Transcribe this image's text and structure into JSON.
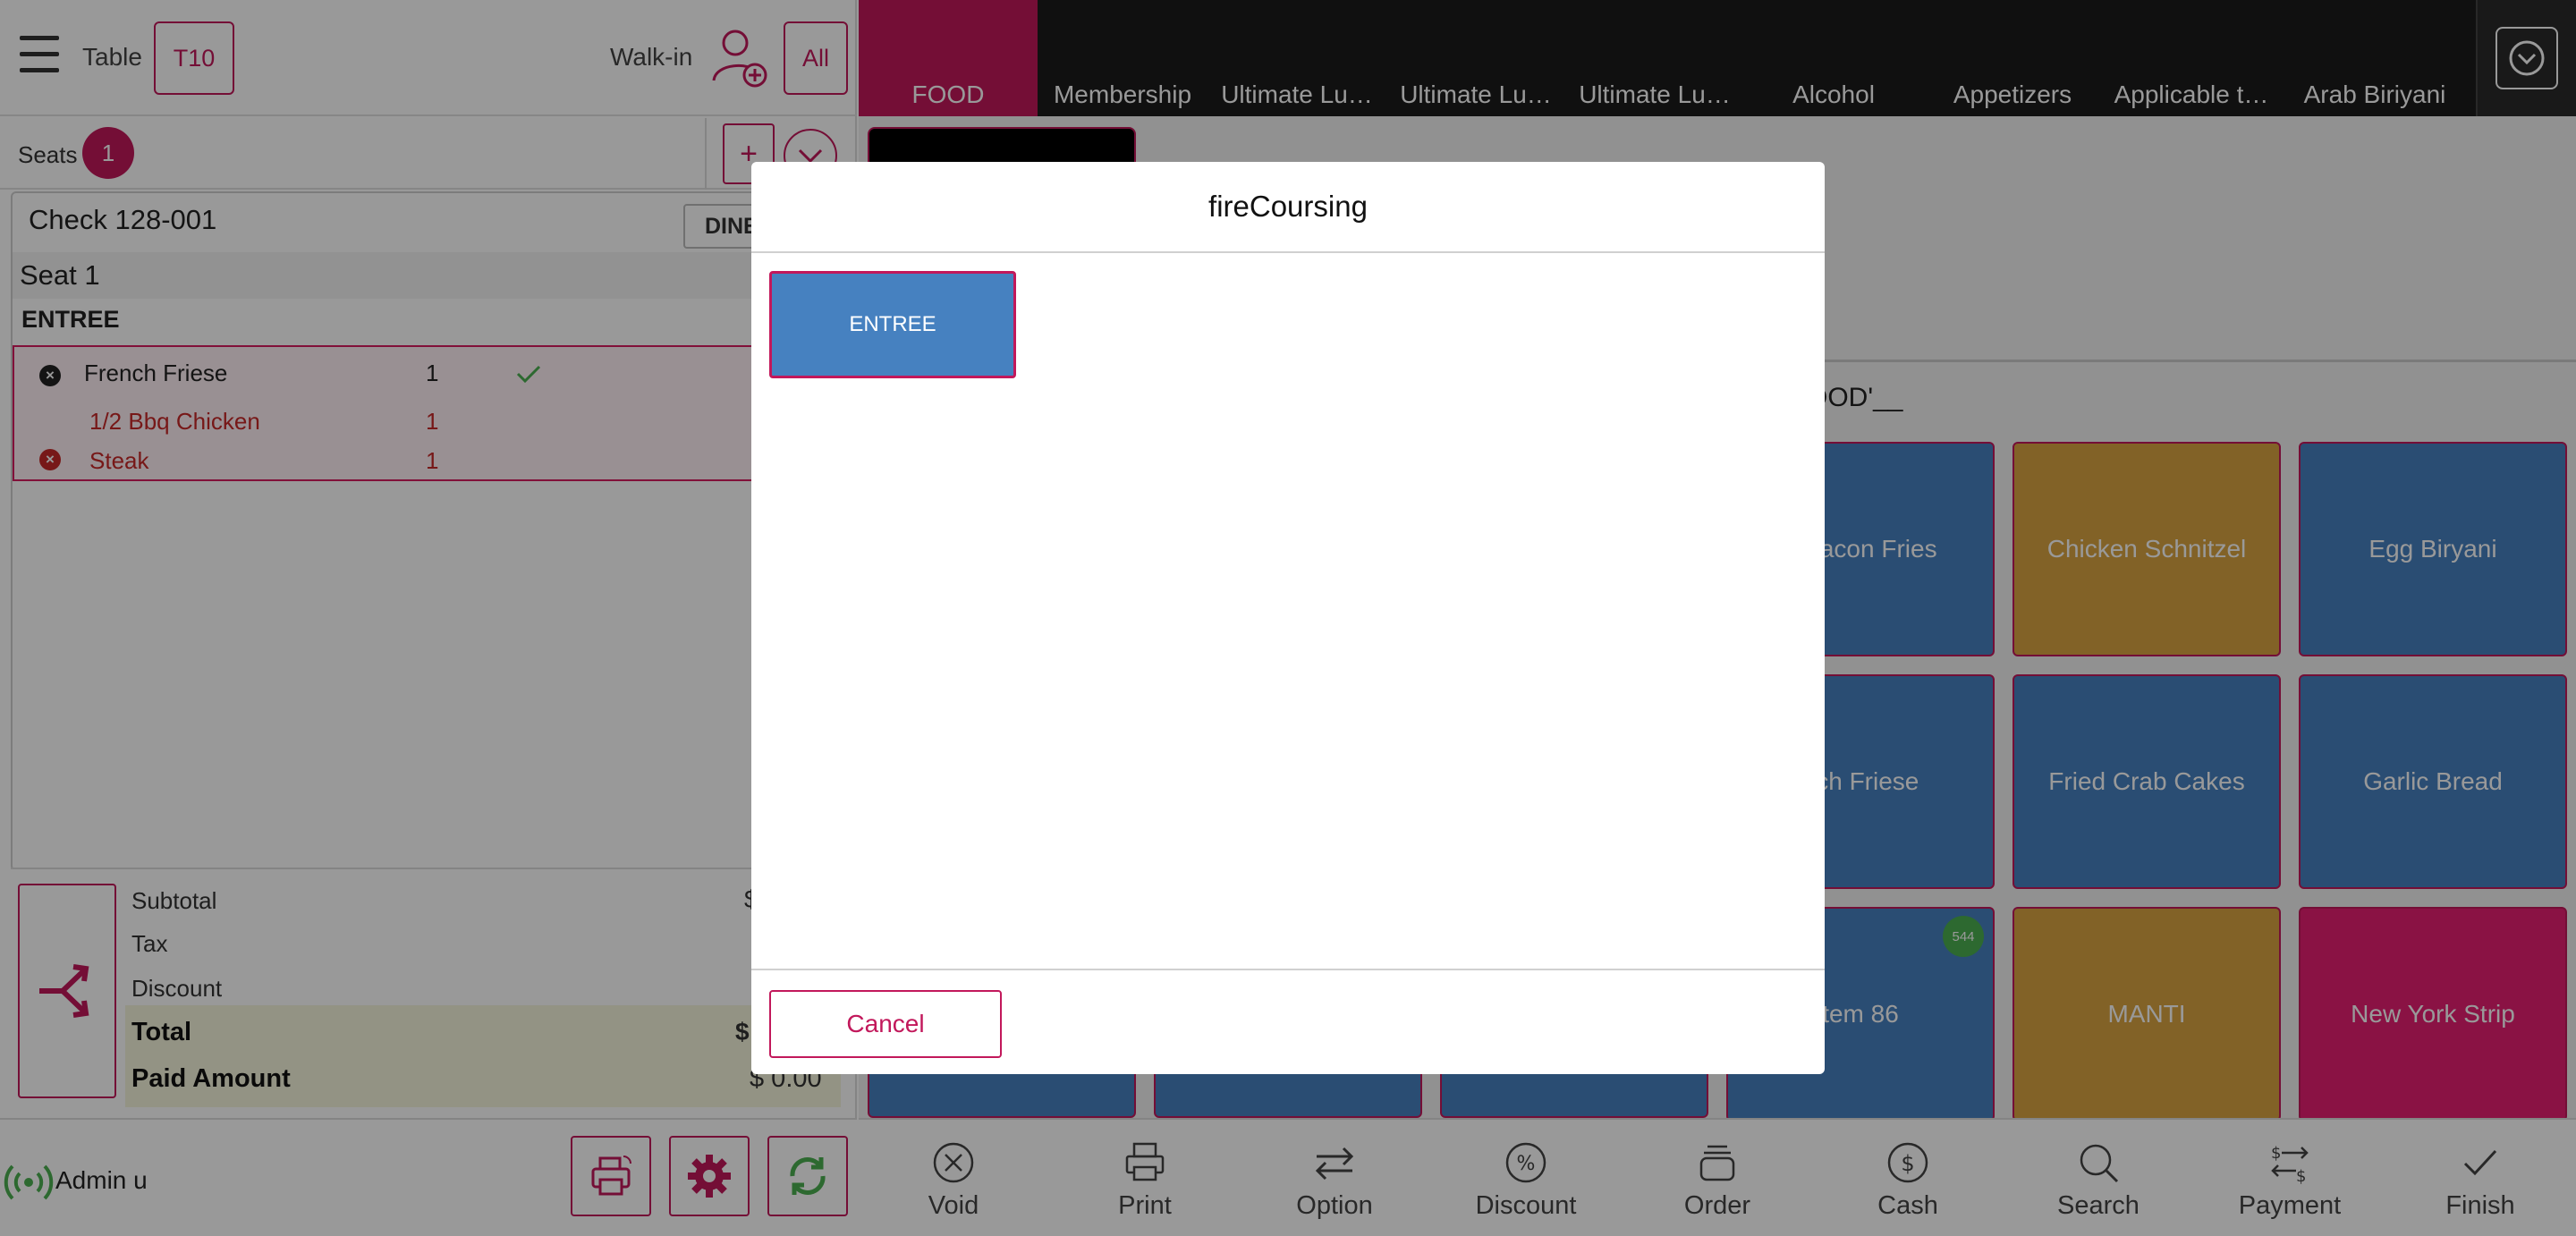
{
  "header": {
    "table_label": "Table",
    "table_value": "T10",
    "walkin_label": "Walk-in",
    "all_label": "All"
  },
  "seats": {
    "label": "Seats",
    "count": "1",
    "add_label": "+"
  },
  "check": {
    "title": "Check 128-001",
    "dine_label": "DINE",
    "seat_label": "Seat 1",
    "course_label": "ENTREE",
    "items": [
      {
        "name": "French Friese",
        "qty": "1"
      },
      {
        "name": "1/2 Bbq Chicken",
        "qty": "1"
      },
      {
        "name": "Steak",
        "qty": "1"
      }
    ]
  },
  "totals": {
    "subtotal_label": "Subtotal",
    "subtotal_value": "$",
    "tax_label": "Tax",
    "discount_label": "Discount",
    "total_label": "Total",
    "total_value": "$",
    "paid_label": "Paid Amount",
    "paid_value": "$ 0.00"
  },
  "user": {
    "name": "Admin u"
  },
  "categories": [
    {
      "label": "FOOD"
    },
    {
      "label": "Membership"
    },
    {
      "label": "Ultimate Lu…"
    },
    {
      "label": "Ultimate Lu…"
    },
    {
      "label": "Ultimate Lu…"
    },
    {
      "label": "Alcohol"
    },
    {
      "label": "Appetizers"
    },
    {
      "label": "Applicable t…"
    },
    {
      "label": "Arab Biriyani"
    }
  ],
  "menu": {
    "title": "OOD'__",
    "tiles": [
      {
        "label": "y Bacon Fries"
      },
      {
        "label": "Chicken Schnitzel"
      },
      {
        "label": "Egg Biryani"
      },
      {
        "label": "nch Friese"
      },
      {
        "label": "Fried Crab Cakes"
      },
      {
        "label": "Garlic Bread"
      },
      {
        "label": "tem 86",
        "badge": "544"
      },
      {
        "label": "MANTI"
      },
      {
        "label": "New York Strip"
      }
    ]
  },
  "bottom_actions": [
    {
      "label": "Void",
      "icon": "void-icon"
    },
    {
      "label": "Print",
      "icon": "print-icon"
    },
    {
      "label": "Option",
      "icon": "option-icon"
    },
    {
      "label": "Discount",
      "icon": "discount-icon"
    },
    {
      "label": "Order",
      "icon": "order-icon"
    },
    {
      "label": "Cash",
      "icon": "cash-icon"
    },
    {
      "label": "Search",
      "icon": "search-icon"
    },
    {
      "label": "Payment",
      "icon": "payment-icon"
    },
    {
      "label": "Finish",
      "icon": "finish-icon"
    }
  ],
  "modal": {
    "title": "fireCoursing",
    "course_button": "ENTREE",
    "cancel_label": "Cancel"
  },
  "colors": {
    "accent": "#c2185b",
    "tile_blue": "#4681c0",
    "tile_gold": "#d9a441",
    "tile_pink": "#e61e72",
    "status_green": "#4caf50"
  }
}
